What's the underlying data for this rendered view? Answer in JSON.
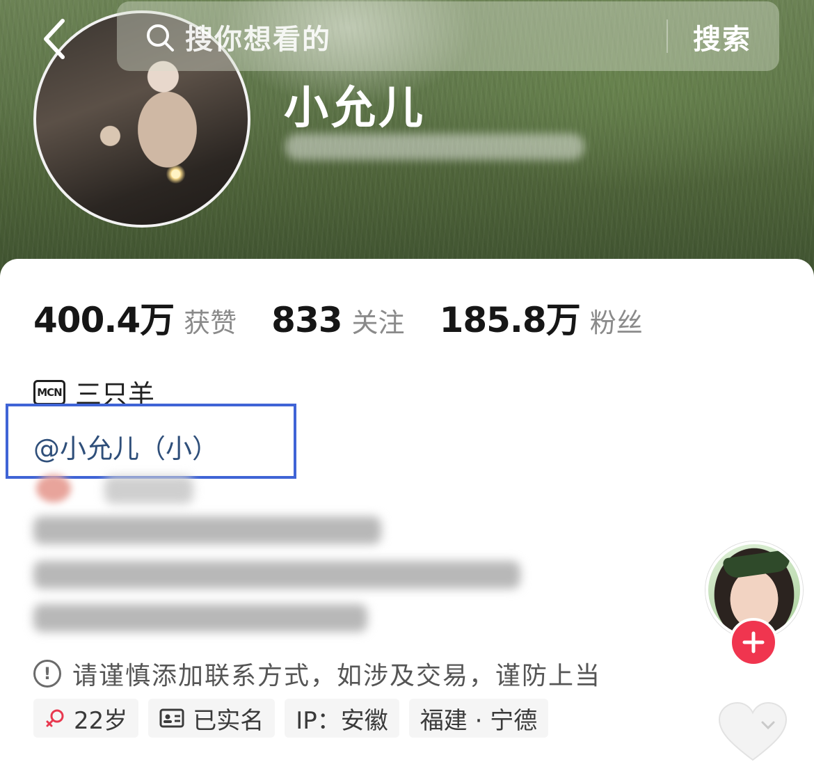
{
  "search": {
    "placeholder": "搜你想看的",
    "button_label": "搜索"
  },
  "profile": {
    "name": "小允儿"
  },
  "stats": [
    {
      "value": "400.4万",
      "label": "获赞"
    },
    {
      "value": "833",
      "label": "关注"
    },
    {
      "value": "185.8万",
      "label": "粉丝"
    }
  ],
  "mcn": {
    "badge": "MCN",
    "name": "三只羊"
  },
  "mention": "@小允儿（小）",
  "warning": "请谨慎添加联系方式，如涉及交易，谨防上当",
  "tags": {
    "age": "22岁",
    "verified": "已实名",
    "ip": "IP：安徽",
    "location": "福建 · 宁德"
  },
  "colors": {
    "accent_red": "#f0354f",
    "link_blue": "#2f4f7a",
    "highlight_border": "#3f64d6",
    "cover_green": "#5e7549"
  },
  "icons": [
    "back-arrow-icon",
    "search-icon",
    "mcn-icon",
    "warning-icon",
    "female-icon",
    "id-card-icon",
    "plus-icon",
    "heart-icon"
  ]
}
